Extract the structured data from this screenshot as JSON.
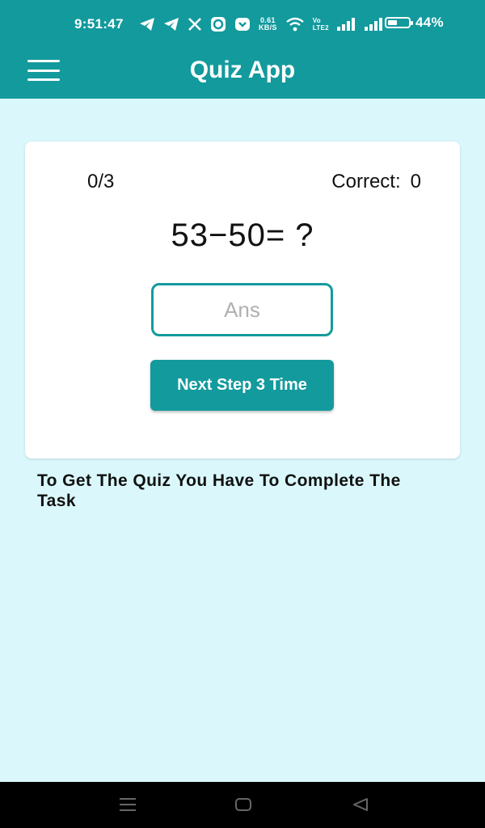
{
  "status_bar": {
    "time": "9:51:47",
    "net_speed_value": "0.61",
    "net_speed_unit": "KB/S",
    "volte_top": "Vo",
    "volte_bottom": "LTE2",
    "battery_percent": "44%",
    "battery_level": 0.44,
    "icons": [
      "telegram-icon",
      "telegram-icon",
      "x-icon",
      "circle-app-icon",
      "pocket-icon",
      "wifi-icon",
      "signal-icon",
      "signal-icon",
      "battery-icon"
    ]
  },
  "toolbar": {
    "title": "Quiz App",
    "menu_icon": "hamburger-menu-icon"
  },
  "quiz": {
    "progress": "0/3",
    "correct_label": "Correct:",
    "correct_count": "0",
    "question": "53−50= ?",
    "answer_placeholder": "Ans",
    "answer_value": "",
    "next_button_label": "Next Step 3 Time"
  },
  "task_text": "To Get The Quiz You Have To Complete The Task",
  "colors": {
    "primary": "#139a9d",
    "background": "#daf8fc",
    "card": "#ffffff"
  },
  "nav_bar": {
    "icons": [
      "recent-apps-icon",
      "home-icon",
      "back-icon"
    ]
  }
}
